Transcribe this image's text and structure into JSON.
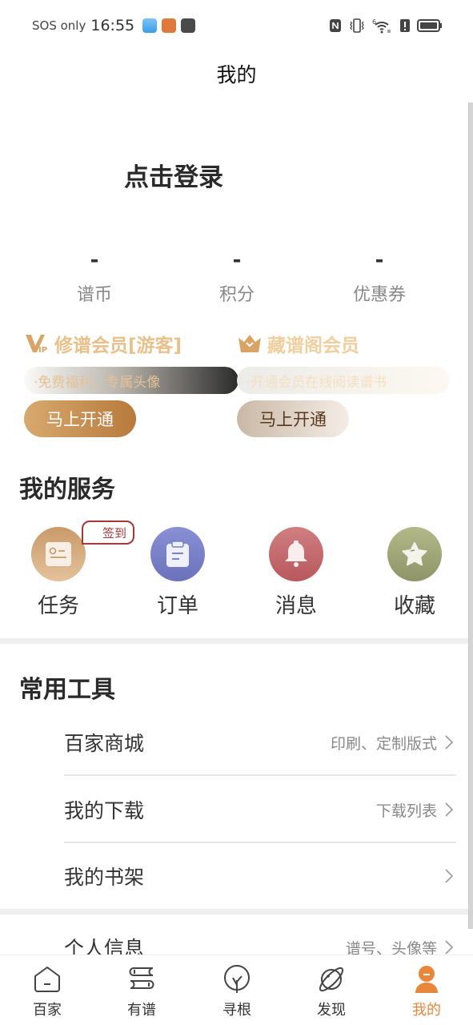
{
  "status_bar": {
    "carrier": "SOS only",
    "time": "16:55",
    "notification_apps": [
      "weather-app",
      "novel-app",
      "game-app"
    ],
    "indicators": [
      "nfc-icon",
      "vibrate-icon",
      "wifi-6-icon",
      "alert-icon",
      "battery-icon"
    ]
  },
  "header": {
    "title": "我的"
  },
  "profile": {
    "login_prompt": "点击登录"
  },
  "stats": [
    {
      "value": "-",
      "label": "谱币"
    },
    {
      "value": "-",
      "label": "积分"
    },
    {
      "value": "-",
      "label": "优惠券"
    }
  ],
  "membership": [
    {
      "title": "修谱会员[游客]",
      "subtitle": "·免费福利，专属头像",
      "button": "马上开通",
      "icon": "vip-icon"
    },
    {
      "title": "藏谱阁会员",
      "subtitle": "·开通会员在线阅读谱书",
      "button": "马上开通",
      "icon": "crown-icon"
    }
  ],
  "services": {
    "title": "我的服务",
    "items": [
      {
        "label": "任务",
        "icon": "task-card-icon",
        "badge": "签到",
        "color": "#d4a373"
      },
      {
        "label": "订单",
        "icon": "clipboard-icon",
        "color": "#7a82c8"
      },
      {
        "label": "消息",
        "icon": "bell-icon",
        "color": "#c56e72"
      },
      {
        "label": "收藏",
        "icon": "star-icon",
        "color": "#a4aa7c"
      }
    ]
  },
  "tools": {
    "title": "常用工具",
    "items": [
      {
        "label": "百家商城",
        "hint": "印刷、定制版式"
      },
      {
        "label": "我的下载",
        "hint": "下载列表"
      },
      {
        "label": "我的书架",
        "hint": ""
      }
    ]
  },
  "more": {
    "items": [
      {
        "label": "个人信息",
        "hint": "谱号、头像等"
      }
    ]
  },
  "bottom_nav": {
    "active_index": 4,
    "active_color": "#e8873a",
    "items": [
      {
        "label": "百家",
        "icon": "home-icon"
      },
      {
        "label": "有谱",
        "icon": "books-icon"
      },
      {
        "label": "寻根",
        "icon": "tree-icon"
      },
      {
        "label": "发现",
        "icon": "planet-icon"
      },
      {
        "label": "我的",
        "icon": "user-icon"
      }
    ]
  }
}
